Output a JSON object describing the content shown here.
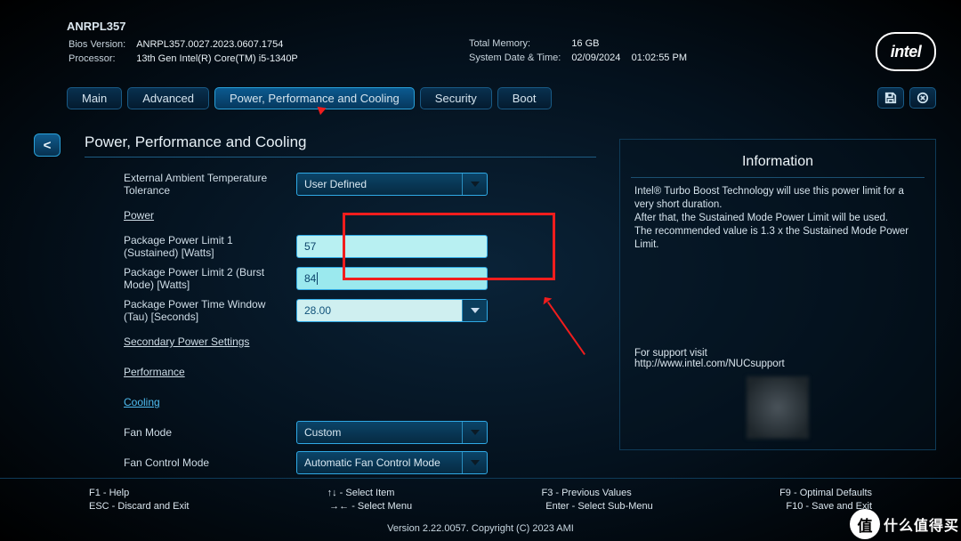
{
  "header": {
    "product": "ANRPL357",
    "bios_label": "Bios Version:",
    "bios_value": "ANRPL357.0027.2023.0607.1754",
    "cpu_label": "Processor:",
    "cpu_value": "13th Gen Intel(R) Core(TM) i5-1340P",
    "mem_label": "Total Memory:",
    "mem_value": "16 GB",
    "dt_label": "System Date & Time:",
    "dt_date": "02/09/2024",
    "dt_time": "01:02:55 PM",
    "logo_text": "intel"
  },
  "nav": {
    "tabs": [
      "Main",
      "Advanced",
      "Power, Performance and Cooling",
      "Security",
      "Boot"
    ],
    "active_index": 2
  },
  "back_label": "<",
  "page": {
    "title": "Power, Performance and Cooling",
    "ext_temp_label": "External Ambient Temperature Tolerance",
    "ext_temp_value": "User Defined",
    "power_heading": "Power",
    "pl1_label": "Package Power Limit 1 (Sustained) [Watts]",
    "pl1_value": "57",
    "pl2_label": "Package Power Limit 2 (Burst Mode) [Watts]",
    "pl2_value": "84",
    "tau_label": "Package Power Time Window (Tau) [Seconds]",
    "tau_value": "28.00",
    "secondary_label": "Secondary Power Settings",
    "performance_label": "Performance",
    "cooling_label": "Cooling",
    "fan_mode_label": "Fan Mode",
    "fan_mode_value": "Custom",
    "fan_control_label": "Fan Control Mode",
    "fan_control_value": "Automatic Fan Control Mode"
  },
  "info": {
    "title": "Information",
    "body": "Intel® Turbo Boost Technology will use this power limit for a very short duration.\nAfter that, the Sustained Mode Power Limit will be used.\nThe recommended value is 1.3 x the Sustained Mode Power Limit.",
    "support_label": "For support visit",
    "support_url": "http://www.intel.com/NUCsupport"
  },
  "footer": {
    "f1": "F1 - Help",
    "esc": "ESC - Discard and Exit",
    "up": "↑↓ - Select Item",
    "lr": "→← - Select Menu",
    "f3": "F3 - Previous Values",
    "enter": "Enter - Select Sub-Menu",
    "f9": "F9 - Optimal Defaults",
    "f10": "F10 - Save and Exit",
    "version": "Version 2.22.0057. Copyright (C) 2023 AMI"
  },
  "watermark": {
    "icon": "值",
    "text": "什么值得买"
  }
}
